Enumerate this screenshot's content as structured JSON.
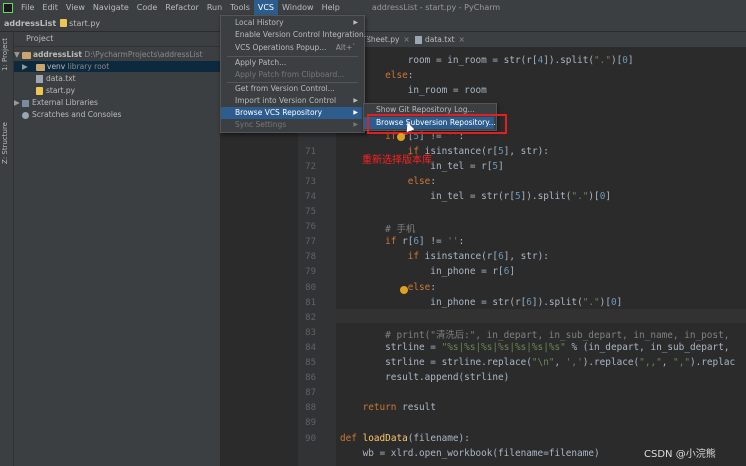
{
  "menubar": {
    "items": [
      "File",
      "Edit",
      "View",
      "Navigate",
      "Code",
      "Refactor",
      "Run",
      "Tools",
      "VCS",
      "Window",
      "Help"
    ],
    "title": "addressList - start.py - PyCharm"
  },
  "breadcrumb": {
    "project": "addressList",
    "file": "start.py"
  },
  "side_tabs": {
    "project": "1: Project",
    "structure": "Z: Structure"
  },
  "project_panel": {
    "header": "Project",
    "root": "addressList",
    "root_path": "D:\\PycharmProjects\\addressList",
    "venv": "venv",
    "venv_note": "library root",
    "data_file": "data.txt",
    "start_file": "start.py",
    "external": "External Libraries",
    "scratches": "Scratches and Consoles"
  },
  "tabs": {
    "sheet": "sheet.py",
    "data": "data.txt"
  },
  "vcs_menu": {
    "items": [
      {
        "label": "Local History",
        "submenu": true
      },
      {
        "label": "Enable Version Control Integration..."
      },
      {
        "label": "VCS Operations Popup...",
        "shortcut": "Alt+`"
      },
      {
        "label": "Apply Patch..."
      },
      {
        "label": "Apply Patch from Clipboard...",
        "disabled": true
      },
      {
        "label": "Get from Version Control..."
      },
      {
        "label": "Import into Version Control",
        "submenu": true
      },
      {
        "label": "Browse VCS Repository",
        "submenu": true,
        "highlighted": true
      },
      {
        "label": "Sync Settings",
        "submenu": true,
        "disabled": true
      }
    ]
  },
  "browse_submenu": {
    "items": [
      {
        "label": "Show Git Repository Log..."
      },
      {
        "label": "Browse Subversion Repository...",
        "highlighted": true
      }
    ]
  },
  "annotation": "重新选择版本库",
  "watermark": "CSDN @小浣熊",
  "code": {
    "line_numbers": [
      "",
      "",
      "",
      "",
      "",
      "",
      "71",
      "72",
      "73",
      "74",
      "75",
      "76",
      "77",
      "78",
      "79",
      "80",
      "81",
      "82",
      "83",
      "84",
      "85",
      "86",
      "87",
      "88",
      "89",
      "90"
    ],
    "lines": [
      "            room = in_room = str(r[4]).split(\".\")[0]",
      "        else:",
      "            in_room = room",
      "",
      "",
      "        if r[5] != '':",
      "            if isinstance(r[5], str):",
      "                in_tel = r[5]",
      "            else:",
      "                in_tel = str(r[5]).split(\".\")[0]",
      "",
      "        # 手机",
      "        if r[6] != '':",
      "            if isinstance(r[6], str):",
      "                in_phone = r[6]",
      "            else:",
      "                in_phone = str(r[6]).split(\".\")[0]",
      "",
      "        # print(\"清洗后:\", in_depart, in_sub_depart, in_name, in_post,",
      "        strline = \"%s|%s|%s|%s|%s|%s|%s\" % (in_depart, in_sub_depart,",
      "        strline = strline.replace(\"\\n\", ',').replace(\",,\", \",\").replac",
      "        result.append(strline)",
      "",
      "    return result",
      "",
      "def loadData(filename):",
      "    wb = xlrd.open_workbook(filename=filename)"
    ]
  },
  "colors": {
    "menu_bg": "#3c3f41",
    "highlight": "#2d5d8e",
    "editor_bg": "#2b2b2b",
    "annotation_red": "#ff2020"
  }
}
